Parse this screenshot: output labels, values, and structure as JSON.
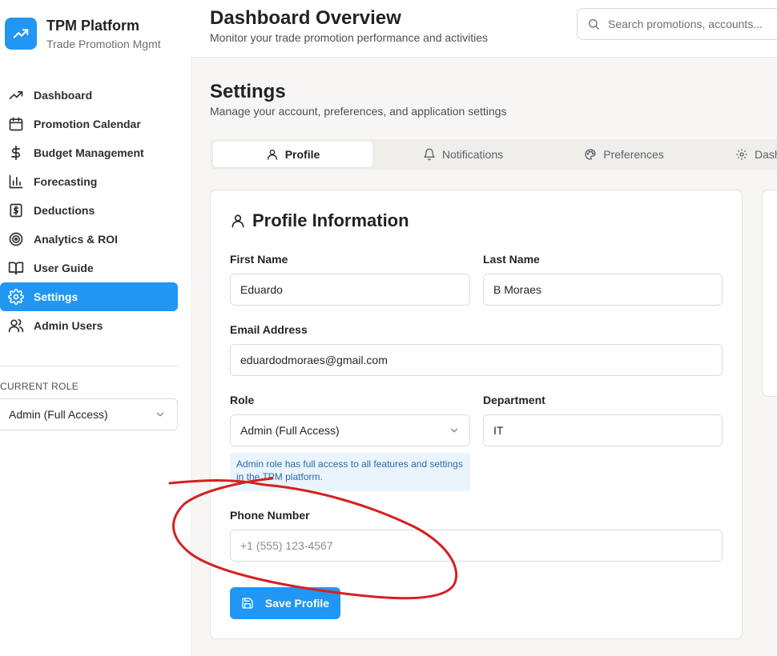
{
  "brand": {
    "title": "TPM Platform",
    "subtitle": "Trade Promotion Mgmt",
    "accent": "#2196f3"
  },
  "sidebar": {
    "items": [
      {
        "label": "Dashboard",
        "icon": "trending-up-icon"
      },
      {
        "label": "Promotion Calendar",
        "icon": "calendar-icon"
      },
      {
        "label": "Budget Management",
        "icon": "dollar-icon"
      },
      {
        "label": "Forecasting",
        "icon": "bar-chart-icon"
      },
      {
        "label": "Deductions",
        "icon": "receipt-dollar-icon"
      },
      {
        "label": "Analytics & ROI",
        "icon": "target-icon"
      },
      {
        "label": "User Guide",
        "icon": "book-icon"
      },
      {
        "label": "Settings",
        "icon": "gear-icon",
        "active": true
      },
      {
        "label": "Admin Users",
        "icon": "users-icon"
      }
    ],
    "role_caption": "CURRENT ROLE",
    "role_value": "Admin (Full Access)"
  },
  "header": {
    "title": "Dashboard Overview",
    "subtitle": "Monitor your trade promotion performance and activities",
    "search_placeholder": "Search promotions, accounts..."
  },
  "settings": {
    "title": "Settings",
    "subtitle": "Manage your account, preferences, and application settings",
    "tabs": [
      {
        "label": "Profile",
        "icon": "user-icon",
        "active": true
      },
      {
        "label": "Notifications",
        "icon": "bell-icon"
      },
      {
        "label": "Preferences",
        "icon": "palette-icon"
      },
      {
        "label": "Dash",
        "icon": "gear-icon"
      }
    ]
  },
  "profile": {
    "title": "Profile Information",
    "first_name_label": "First Name",
    "first_name": "Eduardo",
    "last_name_label": "Last Name",
    "last_name": "B Moraes",
    "email_label": "Email Address",
    "email": "eduardodmoraes@gmail.com",
    "role_label": "Role",
    "role": "Admin (Full Access)",
    "department_label": "Department",
    "department": "IT",
    "role_info": "Admin role has full access to all features and settings in the TPM platform.",
    "phone_label": "Phone Number",
    "phone_placeholder": "+1 (555) 123-4567",
    "save_label": "Save Profile"
  },
  "annotation_color": "#d62020"
}
